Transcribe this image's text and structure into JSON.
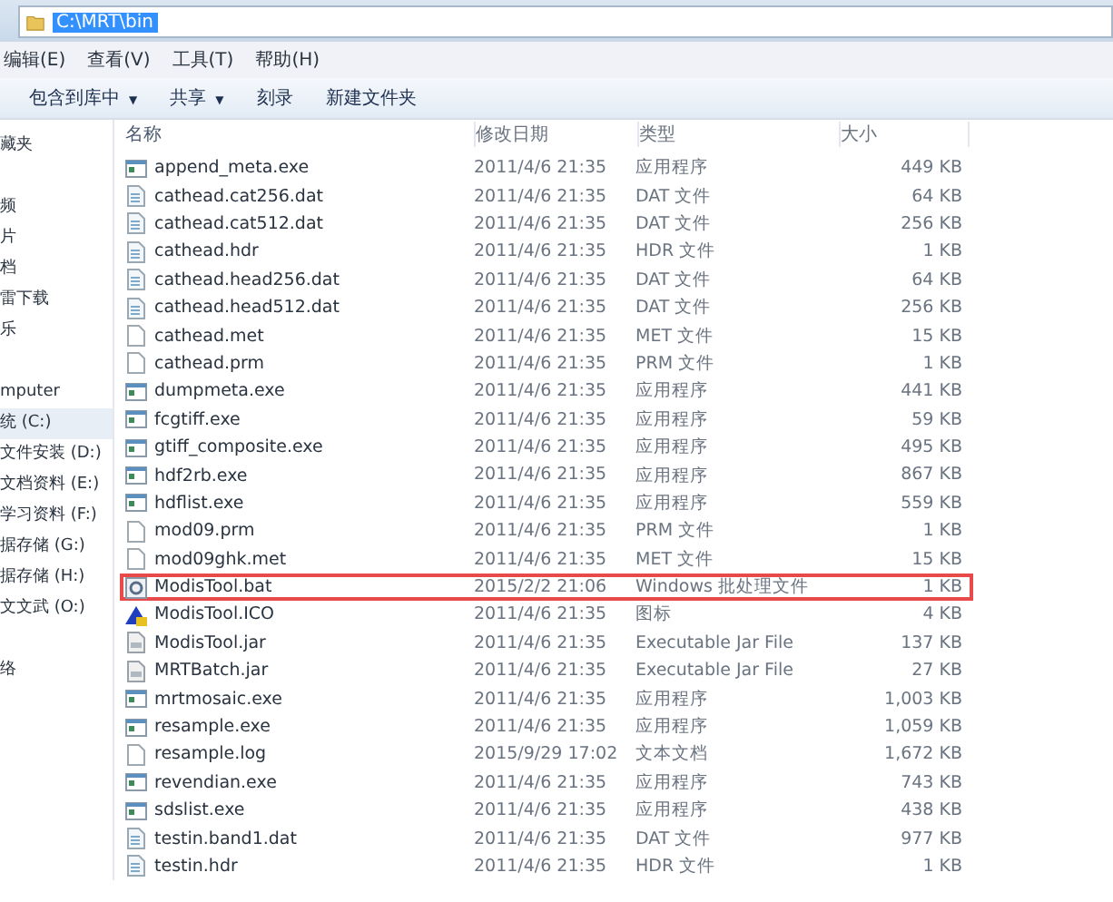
{
  "address_bar": {
    "path": "C:\\MRT\\bin"
  },
  "menu": [
    "编辑(E)",
    "查看(V)",
    "工具(T)",
    "帮助(H)"
  ],
  "toolbar": [
    {
      "label": "包含到库中",
      "caret": "▼"
    },
    {
      "label": "共享",
      "caret": "▼"
    },
    {
      "label": "刻录"
    },
    {
      "label": "新建文件夹"
    }
  ],
  "sidebar": [
    {
      "items": [
        {
          "label": "藏夹",
          "selected": false
        }
      ]
    },
    {
      "items": [
        {
          "label": "频",
          "selected": false
        },
        {
          "label": "片",
          "selected": false
        },
        {
          "label": "档",
          "selected": false
        },
        {
          "label": "雷下载",
          "selected": false
        },
        {
          "label": "乐",
          "selected": false
        }
      ]
    },
    {
      "items": [
        {
          "label": "mputer",
          "selected": false
        },
        {
          "label": "统 (C:)",
          "selected": true
        },
        {
          "label": "文件安装 (D:)",
          "selected": false
        },
        {
          "label": "文档资料 (E:)",
          "selected": false
        },
        {
          "label": "学习资料 (F:)",
          "selected": false
        },
        {
          "label": "据存储 (G:)",
          "selected": false
        },
        {
          "label": "据存储 (H:)",
          "selected": false
        },
        {
          "label": "文文武 (O:)",
          "selected": false
        }
      ]
    },
    {
      "items": [
        {
          "label": "络",
          "selected": false
        }
      ]
    }
  ],
  "table": {
    "columns": [
      "名称",
      "修改日期",
      "类型",
      "大小"
    ],
    "rows": [
      {
        "kind": "exe",
        "name": "append_meta.exe",
        "date": "2011/4/6 21:35",
        "type": "应用程序",
        "size": "449 KB",
        "highlighted": false
      },
      {
        "kind": "dat",
        "name": "cathead.cat256.dat",
        "date": "2011/4/6 21:35",
        "type": "DAT 文件",
        "size": "64 KB",
        "highlighted": false
      },
      {
        "kind": "dat",
        "name": "cathead.cat512.dat",
        "date": "2011/4/6 21:35",
        "type": "DAT 文件",
        "size": "256 KB",
        "highlighted": false
      },
      {
        "kind": "dat",
        "name": "cathead.hdr",
        "date": "2011/4/6 21:35",
        "type": "HDR 文件",
        "size": "1 KB",
        "highlighted": false
      },
      {
        "kind": "dat",
        "name": "cathead.head256.dat",
        "date": "2011/4/6 21:35",
        "type": "DAT 文件",
        "size": "64 KB",
        "highlighted": false
      },
      {
        "kind": "dat",
        "name": "cathead.head512.dat",
        "date": "2011/4/6 21:35",
        "type": "DAT 文件",
        "size": "256 KB",
        "highlighted": false
      },
      {
        "kind": "blank",
        "name": "cathead.met",
        "date": "2011/4/6 21:35",
        "type": "MET 文件",
        "size": "15 KB",
        "highlighted": false
      },
      {
        "kind": "blank",
        "name": "cathead.prm",
        "date": "2011/4/6 21:35",
        "type": "PRM 文件",
        "size": "1 KB",
        "highlighted": false
      },
      {
        "kind": "exe",
        "name": "dumpmeta.exe",
        "date": "2011/4/6 21:35",
        "type": "应用程序",
        "size": "441 KB",
        "highlighted": false
      },
      {
        "kind": "exe",
        "name": "fcgtiff.exe",
        "date": "2011/4/6 21:35",
        "type": "应用程序",
        "size": "59 KB",
        "highlighted": false
      },
      {
        "kind": "exe",
        "name": "gtiff_composite.exe",
        "date": "2011/4/6 21:35",
        "type": "应用程序",
        "size": "495 KB",
        "highlighted": false
      },
      {
        "kind": "exe",
        "name": "hdf2rb.exe",
        "date": "2011/4/6 21:35",
        "type": "应用程序",
        "size": "867 KB",
        "highlighted": false
      },
      {
        "kind": "exe",
        "name": "hdflist.exe",
        "date": "2011/4/6 21:35",
        "type": "应用程序",
        "size": "559 KB",
        "highlighted": false
      },
      {
        "kind": "blank",
        "name": "mod09.prm",
        "date": "2011/4/6 21:35",
        "type": "PRM 文件",
        "size": "1 KB",
        "highlighted": false
      },
      {
        "kind": "blank",
        "name": "mod09ghk.met",
        "date": "2011/4/6 21:35",
        "type": "MET 文件",
        "size": "15 KB",
        "highlighted": false
      },
      {
        "kind": "bat",
        "name": "ModisTool.bat",
        "date": "2015/2/2 21:06",
        "type": "Windows 批处理文件",
        "size": "1 KB",
        "highlighted": true
      },
      {
        "kind": "ico",
        "name": "ModisTool.ICO",
        "date": "2011/4/6 21:35",
        "type": "图标",
        "size": "4 KB",
        "highlighted": false
      },
      {
        "kind": "jar",
        "name": "ModisTool.jar",
        "date": "2011/4/6 21:35",
        "type": "Executable Jar File",
        "size": "137 KB",
        "highlighted": false
      },
      {
        "kind": "jar",
        "name": "MRTBatch.jar",
        "date": "2011/4/6 21:35",
        "type": "Executable Jar File",
        "size": "27 KB",
        "highlighted": false
      },
      {
        "kind": "exe",
        "name": "mrtmosaic.exe",
        "date": "2011/4/6 21:35",
        "type": "应用程序",
        "size": "1,003 KB",
        "highlighted": false
      },
      {
        "kind": "exe",
        "name": "resample.exe",
        "date": "2011/4/6 21:35",
        "type": "应用程序",
        "size": "1,059 KB",
        "highlighted": false
      },
      {
        "kind": "blank",
        "name": "resample.log",
        "date": "2015/9/29 17:02",
        "type": "文本文档",
        "size": "1,672 KB",
        "highlighted": false
      },
      {
        "kind": "exe",
        "name": "revendian.exe",
        "date": "2011/4/6 21:35",
        "type": "应用程序",
        "size": "743 KB",
        "highlighted": false
      },
      {
        "kind": "exe",
        "name": "sdslist.exe",
        "date": "2011/4/6 21:35",
        "type": "应用程序",
        "size": "438 KB",
        "highlighted": false
      },
      {
        "kind": "dat",
        "name": "testin.band1.dat",
        "date": "2011/4/6 21:35",
        "type": "DAT 文件",
        "size": "977 KB",
        "highlighted": false
      },
      {
        "kind": "dat",
        "name": "testin.hdr",
        "date": "2011/4/6 21:35",
        "type": "HDR 文件",
        "size": "1 KB",
        "highlighted": false
      }
    ]
  }
}
